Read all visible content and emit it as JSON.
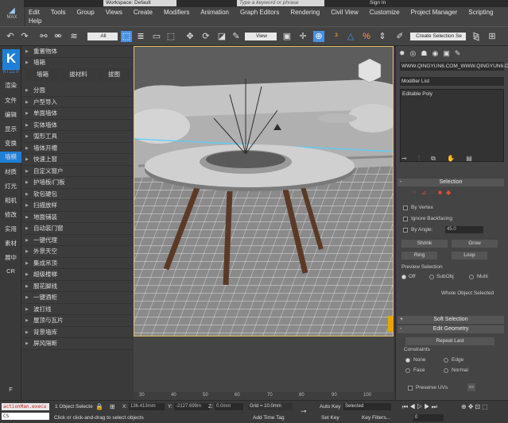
{
  "title_bar": {
    "app_label": "MAX",
    "workspace": "Workspace: Default",
    "search_placeholder": "Type a keyword or phrase",
    "sign_in": "Sign In"
  },
  "menu": [
    "Edit",
    "Tools",
    "Group",
    "Views",
    "Create",
    "Modifiers",
    "Animation",
    "Graph Editors",
    "Rendering",
    "Civil View",
    "Customize",
    "Project Manager",
    "Scripting",
    "Help"
  ],
  "toolbar": {
    "filter": "All",
    "view": "View",
    "selection_set": "Create Selection Se"
  },
  "left_bar": {
    "k_logo": "K",
    "version": "KT22.0",
    "items": [
      "渲染",
      "文件",
      "编辑",
      "显示",
      "变换",
      "墙模",
      "材质",
      "灯光",
      "相机",
      "修改",
      "实用",
      "素材",
      "展中",
      "CR"
    ],
    "bottom": "F"
  },
  "plugin": {
    "items_top": [
      "重置物体",
      "墙箱"
    ],
    "subtabs": [
      "墙箱",
      "拔材料",
      "拔图"
    ],
    "items": [
      "分面",
      "户型导入",
      "单面墙体",
      "实体墙体",
      "弧形工具",
      "墙体开槽",
      "快速上窗",
      "自定义窗户",
      "护墙板/门板",
      "软包硬包",
      "扫描放样",
      "地面铺装",
      "自动装门窗",
      "一键代理",
      "外景天空",
      "集成吊顶",
      "超级楼梯",
      "服花脚线",
      "一键酒柜",
      "波打线",
      "屋顶与瓦片",
      "背景墙库",
      "屏风隔断"
    ]
  },
  "command_panel": {
    "object_name": "WWW.QINGYUN6.COM_WWW.QINGYUN6.COM",
    "modifier_list": "Modifier List",
    "stack_item": "Editable Poly",
    "selection": {
      "title": "Selection",
      "by_vertex": "By Vertex",
      "ignore_backfacing": "Ignore Backfacing",
      "by_angle": "By Angle:",
      "angle_value": "45.0",
      "shrink": "Shrink",
      "grow": "Grow",
      "ring": "Ring",
      "loop": "Loop",
      "preview_title": "Preview Selection",
      "off": "Off",
      "subobj": "SubObj",
      "multi": "Multi",
      "whole": "Whole Object Selected"
    },
    "soft_selection": "Soft Selection",
    "edit_geometry": "Edit Geometry",
    "repeat_last": "Repeat Last",
    "constraints": "Constraints",
    "none": "None",
    "edge": "Edge",
    "face": "Face",
    "normal": "Normal",
    "preserve_uvs": "Preserve UVs"
  },
  "ruler": [
    "30",
    "40",
    "50",
    "60",
    "70",
    "80",
    "90",
    "100"
  ],
  "status": {
    "maxscript": "actionMan.execu",
    "maxscript2": "CS",
    "objects": "1 Object Selecte",
    "hint": "Click or click-and-drag to select objects",
    "x_label": "X:",
    "x": "136.413mm",
    "y_label": "Y:",
    "y": "-2127.699m",
    "z_label": "Z:",
    "z": "0.0mm",
    "grid": "Grid = 10.0mm",
    "add_time_tag": "Add Time Tag",
    "auto_key": "Auto Key",
    "selected": "Selected",
    "set_key": "Set Key",
    "key_filters": "Key Filters...",
    "frame": "0"
  }
}
